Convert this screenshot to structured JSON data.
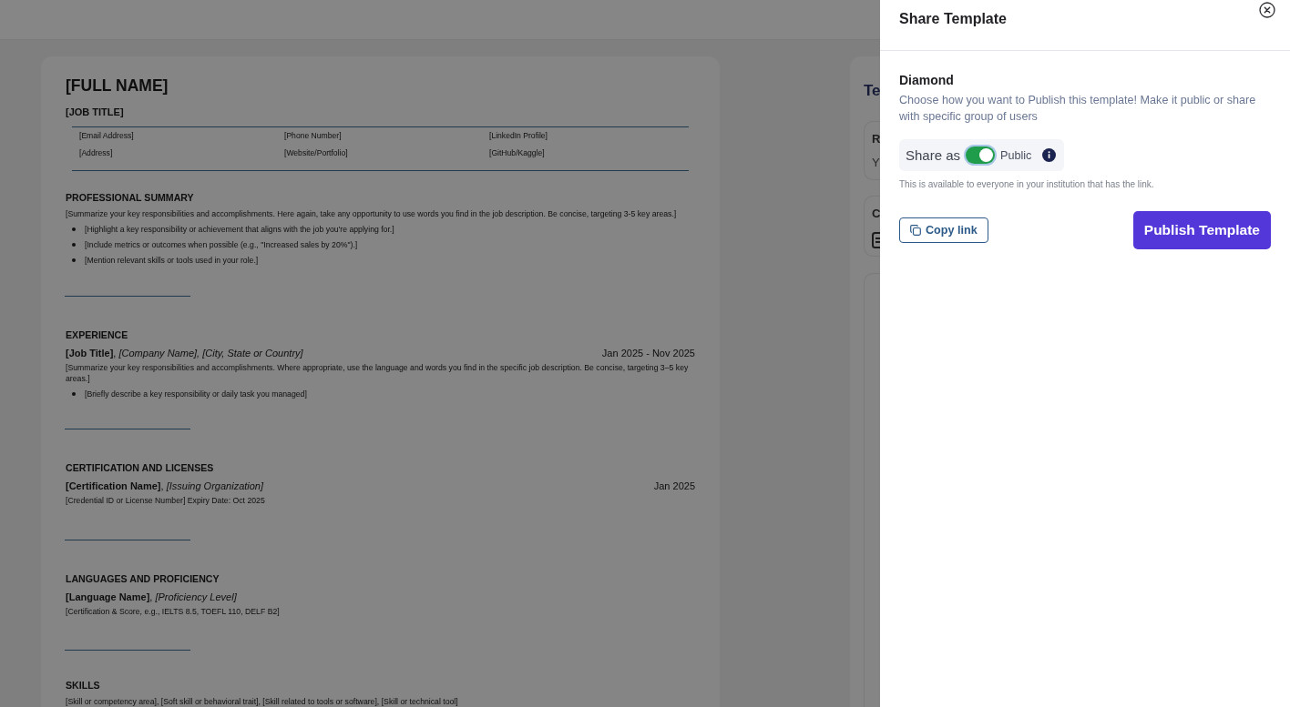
{
  "resume": {
    "name": "[FULL NAME]",
    "job_title": "[JOB TITLE]",
    "contacts": [
      [
        "[Email Address]",
        "[Phone Number]",
        "[LinkedIn Profile]"
      ],
      [
        "[Address]",
        "[Website/Portfolio]",
        "[GitHub/Kaggle]"
      ]
    ],
    "sections": [
      {
        "heading": "PROFESSIONAL SUMMARY",
        "entries": [
          {
            "kind": "paragraph",
            "text": "[Summarize your key responsibilities and accomplishments. Here again, take any opportunity to use words you find in the job description. Be concise, targeting 3-5 key areas.]"
          },
          {
            "kind": "bullets",
            "items": [
              "[Highlight a key responsibility or achievement that aligns with the job you're applying for.]",
              "[Include metrics or outcomes when possible (e.g., \"Increased sales by 20%\").]",
              "[Mention relevant skills or tools used in your role.]"
            ]
          }
        ]
      },
      {
        "heading": "EXPERIENCE",
        "entries": [
          {
            "kind": "title_line",
            "title": "**[Job Title]**, *[Company Name], [City, State or Country]*",
            "date": "Jan 2025 - Nov 2025"
          },
          {
            "kind": "paragraph",
            "text": "[Summarize your key responsibilities and accomplishments. Where appropriate, use the language and words you find in the specific job description. Be concise, targeting 3–5 key areas.]"
          },
          {
            "kind": "bullets",
            "items": [
              "[Briefly describe a key responsibility or daily task you managed]"
            ]
          }
        ]
      },
      {
        "heading": "CERTIFICATION AND LICENSES",
        "entries": [
          {
            "kind": "title_line",
            "title": "**[Certification Name]**, *[Issuing Organization]*",
            "date": "Jan 2025"
          },
          {
            "kind": "paragraph",
            "text": "[Credential ID or License Number] Expiry Date: Oct 2025"
          }
        ]
      },
      {
        "heading": "LANGUAGES AND PROFICIENCY",
        "entries": [
          {
            "kind": "title_line",
            "title": "**[Language Name]**, *[Proficiency Level]*"
          },
          {
            "kind": "paragraph",
            "text": "[Certification & Score, e.g., IELTS 8.5, TOEFL 110, DELF B2]"
          }
        ]
      },
      {
        "heading": "SKILLS",
        "entries": [
          {
            "kind": "paragraph",
            "text": "[Skill or competency area], [Soft skill or behavioral trait], [Skill related to tools or software], [Skill or technical tool]"
          }
        ]
      }
    ]
  },
  "side_panel": {
    "title": "Te",
    "cards": [
      {
        "kind": "text",
        "title": "R",
        "text": "Y"
      },
      {
        "kind": "icon",
        "title": "C"
      },
      {
        "kind": "blank"
      }
    ]
  },
  "drawer": {
    "title": "Share Template",
    "template_name": "Diamond",
    "description": "Choose how you want to Publish this template! Make it public or share with specific group of users",
    "share": {
      "label": "Share as",
      "on": true,
      "option": "Public"
    },
    "note": "This is available to everyone in your institution that has the link.",
    "copy_button": "Copy link",
    "publish_button": "Publish Template"
  }
}
